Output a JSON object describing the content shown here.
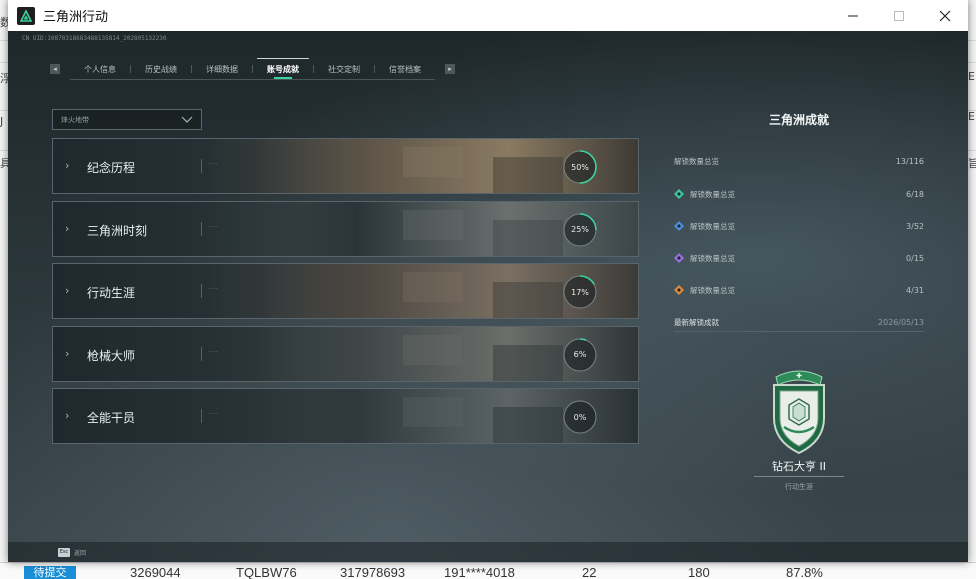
{
  "window": {
    "title": "三角洲行动"
  },
  "uid": "CN UID:10870318683488135814_202805132230",
  "tabs": [
    {
      "label": "个人信息",
      "active": false
    },
    {
      "label": "历史战绩",
      "active": false
    },
    {
      "label": "详细数据",
      "active": false
    },
    {
      "label": "账号成就",
      "active": true
    },
    {
      "label": "社交定制",
      "active": false
    },
    {
      "label": "信誉档案",
      "active": false
    }
  ],
  "filter": {
    "value": "烽火地带"
  },
  "categories": [
    {
      "label": "纪念历程",
      "progress": 50,
      "progress_text": "50%"
    },
    {
      "label": "三角洲时刻",
      "progress": 25,
      "progress_text": "25%"
    },
    {
      "label": "行动生涯",
      "progress": 17,
      "progress_text": "17%"
    },
    {
      "label": "枪械大师",
      "progress": 6,
      "progress_text": "6%"
    },
    {
      "label": "全能干员",
      "progress": 0,
      "progress_text": "0%"
    }
  ],
  "panel": {
    "title": "三角洲成就",
    "total": {
      "label": "解锁数量总览",
      "value": "13/116"
    },
    "tiers": [
      {
        "label": "解锁数量总览",
        "value": "6/18",
        "icon": "green-tier-icon",
        "color": "#3cc9a0"
      },
      {
        "label": "解锁数量总览",
        "value": "3/52",
        "icon": "blue-tier-icon",
        "color": "#4b8fe0"
      },
      {
        "label": "解锁数量总览",
        "value": "0/15",
        "icon": "purple-tier-icon",
        "color": "#9a6ee0"
      },
      {
        "label": "解锁数量总览",
        "value": "4/31",
        "icon": "orange-tier-icon",
        "color": "#e08a3c"
      }
    ],
    "latest": {
      "label": "最新解锁成就",
      "date": "2026/05/13"
    }
  },
  "badge": {
    "name": "钻石大亨 II",
    "category": "行动生涯"
  },
  "footer": {
    "key": "Esc",
    "label": "返回"
  },
  "background": {
    "row_values": [
      "3269044",
      "TQLBW76",
      "317978693",
      "191****4018",
      "22",
      "180",
      "87.8%"
    ],
    "tag": "待提交",
    "left_chars": [
      "数",
      "浮",
      "J",
      "具"
    ],
    "right_chars": [
      "E",
      "E",
      "吕",
      "旨"
    ]
  }
}
